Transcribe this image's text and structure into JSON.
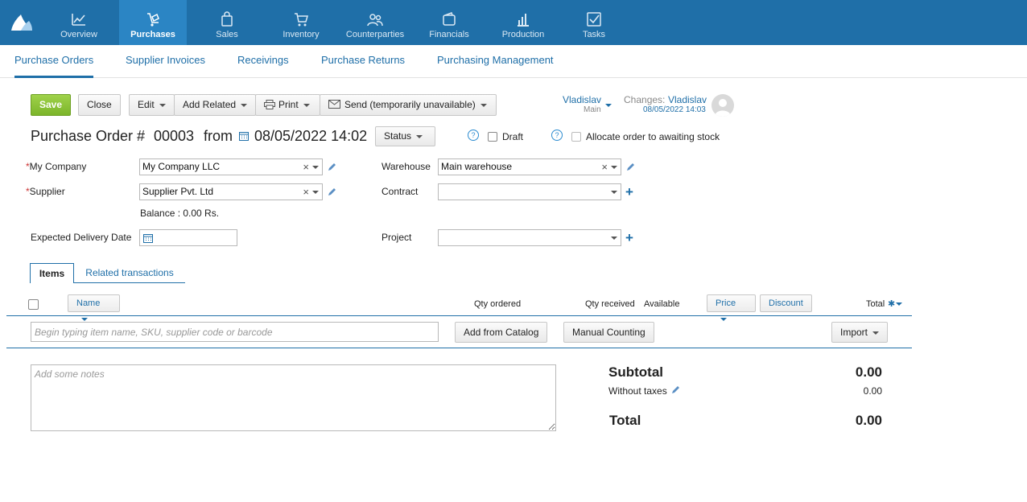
{
  "nav": {
    "items": [
      {
        "label": "Overview",
        "icon": "chart-line-icon"
      },
      {
        "label": "Purchases",
        "icon": "cart-dolly-icon"
      },
      {
        "label": "Sales",
        "icon": "shopping-bag-icon"
      },
      {
        "label": "Inventory",
        "icon": "cart-icon"
      },
      {
        "label": "Counterparties",
        "icon": "people-icon"
      },
      {
        "label": "Financials",
        "icon": "wallet-icon"
      },
      {
        "label": "Production",
        "icon": "bar-chart-icon"
      },
      {
        "label": "Tasks",
        "icon": "checkbox-icon"
      }
    ],
    "active": "Purchases"
  },
  "subnav": {
    "items": [
      "Purchase Orders",
      "Supplier Invoices",
      "Receivings",
      "Purchase Returns",
      "Purchasing Management"
    ],
    "active": "Purchase Orders"
  },
  "toolbar": {
    "save": "Save",
    "close": "Close",
    "edit": "Edit",
    "add_related": "Add Related",
    "print": "Print",
    "send": "Send (temporarily unavailable)"
  },
  "user": {
    "name": "Vladislav",
    "role": "Main",
    "changes_label": "Changes:",
    "changes_user": "Vladislav",
    "changes_time": "08/05/2022 14:03"
  },
  "header": {
    "doc_label": "Purchase Order #",
    "doc_number": "00003",
    "from_label": "from",
    "date": "08/05/2022 14:02",
    "status": "Status",
    "draft_label": "Draft",
    "allocate_label": "Allocate order to awaiting stock"
  },
  "form": {
    "my_company_label": "My Company",
    "my_company_value": "My Company LLC",
    "supplier_label": "Supplier",
    "supplier_value": "Supplier Pvt. Ltd",
    "balance": "Balance : 0.00 Rs.",
    "delivery_label": "Expected Delivery Date",
    "warehouse_label": "Warehouse",
    "warehouse_value": "Main warehouse",
    "contract_label": "Contract",
    "project_label": "Project"
  },
  "tabs": {
    "items": "Items",
    "related": "Related transactions"
  },
  "table": {
    "name": "Name",
    "qty_ordered": "Qty ordered",
    "qty_received": "Qty received",
    "available": "Available",
    "price": "Price",
    "discount": "Discount",
    "total": "Total"
  },
  "items_bar": {
    "search_placeholder": "Begin typing item name, SKU, supplier code or barcode",
    "add_catalog": "Add from Catalog",
    "manual_counting": "Manual Counting",
    "import": "Import"
  },
  "notes_placeholder": "Add some notes",
  "totals": {
    "subtotal_label": "Subtotal",
    "subtotal_value": "0.00",
    "tax_label": "Without taxes",
    "tax_value": "0.00",
    "total_label": "Total",
    "total_value": "0.00"
  }
}
